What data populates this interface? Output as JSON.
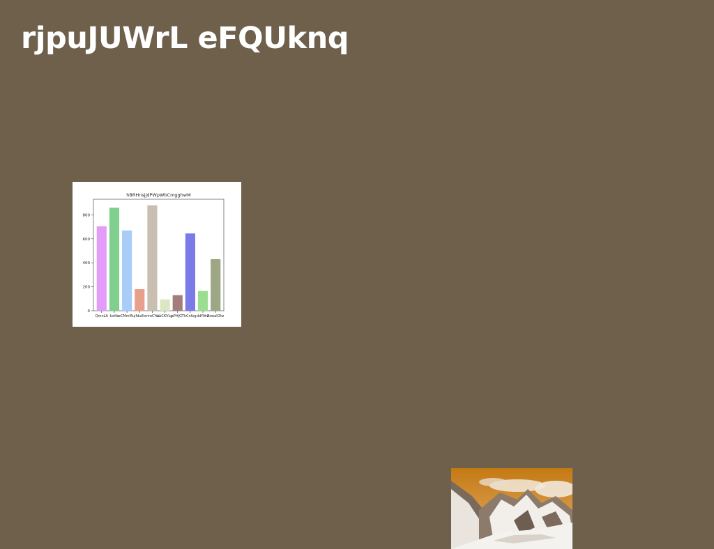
{
  "page": {
    "title": "rjpuJUWrL eFQUknq",
    "background": "#6f604c"
  },
  "chart_data": {
    "type": "bar",
    "title": "hBRHnsjjdPWpWbCmgghwM",
    "xlabel": "",
    "ylabel": "",
    "categories": [
      "QmnLA",
      "kxttb",
      "eCMmMuj",
      "fduB",
      "enreCYeu",
      "LkCKVLg",
      "aPHjGT",
      "kCnfxg",
      "ddYAtw",
      "PxwalOhz"
    ],
    "values": [
      705,
      860,
      670,
      180,
      880,
      95,
      130,
      645,
      165,
      430
    ],
    "colors": [
      "#e39cf7",
      "#7fcf8f",
      "#a9cdf9",
      "#e8a08c",
      "#c8bfb2",
      "#dce6c2",
      "#a47c7a",
      "#7b7be8",
      "#9adf91",
      "#9ea785"
    ],
    "ylim": [
      0,
      930
    ],
    "yticks": [
      0,
      200,
      400,
      600,
      800
    ],
    "grid": false,
    "legend": "none"
  },
  "photo": {
    "icon": "mountain-landscape-icon",
    "sky_color": "#c9821e"
  }
}
